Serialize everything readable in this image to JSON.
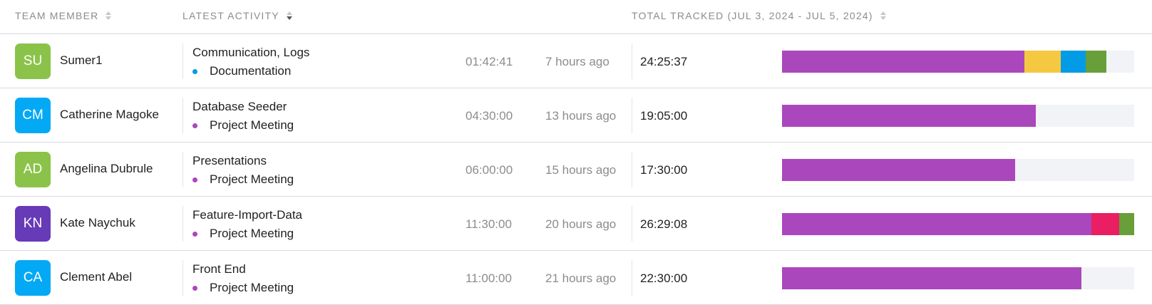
{
  "header": {
    "col_member": "TEAM MEMBER",
    "col_activity": "LATEST ACTIVITY",
    "col_total": "TOTAL TRACKED (JUL 3, 2024 - JUL 5, 2024)"
  },
  "colors": {
    "purple": "#ab47bc",
    "yellow": "#f5c842",
    "blue": "#039be5",
    "green": "#689f38",
    "pink": "#e91e63",
    "track": "#f1f3f6"
  },
  "rows": [
    {
      "initials": "SU",
      "avatar_color": "#8bc34a",
      "name": "Sumer1",
      "activity": "Communication, Logs",
      "project": "Documentation",
      "project_color": "#039be5",
      "duration": "01:42:41",
      "ago": "7 hours ago",
      "total": "24:25:37",
      "segments": [
        {
          "color": "#ab47bc",
          "fraction": 0.688
        },
        {
          "color": "#f5c842",
          "fraction": 0.104
        },
        {
          "color": "#039be5",
          "fraction": 0.071
        },
        {
          "color": "#689f38",
          "fraction": 0.058
        }
      ]
    },
    {
      "initials": "CM",
      "avatar_color": "#03a9f4",
      "name": "Catherine Magoke",
      "activity": "Database Seeder",
      "project": "Project Meeting",
      "project_color": "#ab47bc",
      "duration": "04:30:00",
      "ago": "13 hours ago",
      "total": "19:05:00",
      "segments": [
        {
          "color": "#ab47bc",
          "fraction": 0.721
        }
      ]
    },
    {
      "initials": "AD",
      "avatar_color": "#8bc34a",
      "name": "Angelina Dubrule",
      "activity": "Presentations",
      "project": "Project Meeting",
      "project_color": "#ab47bc",
      "duration": "06:00:00",
      "ago": "15 hours ago",
      "total": "17:30:00",
      "segments": [
        {
          "color": "#ab47bc",
          "fraction": 0.661
        }
      ]
    },
    {
      "initials": "KN",
      "avatar_color": "#673ab7",
      "name": "Kate Naychuk",
      "activity": "Feature-Import-Data",
      "project": "Project Meeting",
      "project_color": "#ab47bc",
      "duration": "11:30:00",
      "ago": "20 hours ago",
      "total": "26:29:08",
      "segments": [
        {
          "color": "#ab47bc",
          "fraction": 0.879
        },
        {
          "color": "#e91e63",
          "fraction": 0.079
        },
        {
          "color": "#689f38",
          "fraction": 0.042
        }
      ]
    },
    {
      "initials": "CA",
      "avatar_color": "#03a9f4",
      "name": "Clement Abel",
      "activity": "Front End",
      "project": "Project Meeting",
      "project_color": "#ab47bc",
      "duration": "11:00:00",
      "ago": "21 hours ago",
      "total": "22:30:00",
      "segments": [
        {
          "color": "#ab47bc",
          "fraction": 0.85
        }
      ]
    }
  ]
}
